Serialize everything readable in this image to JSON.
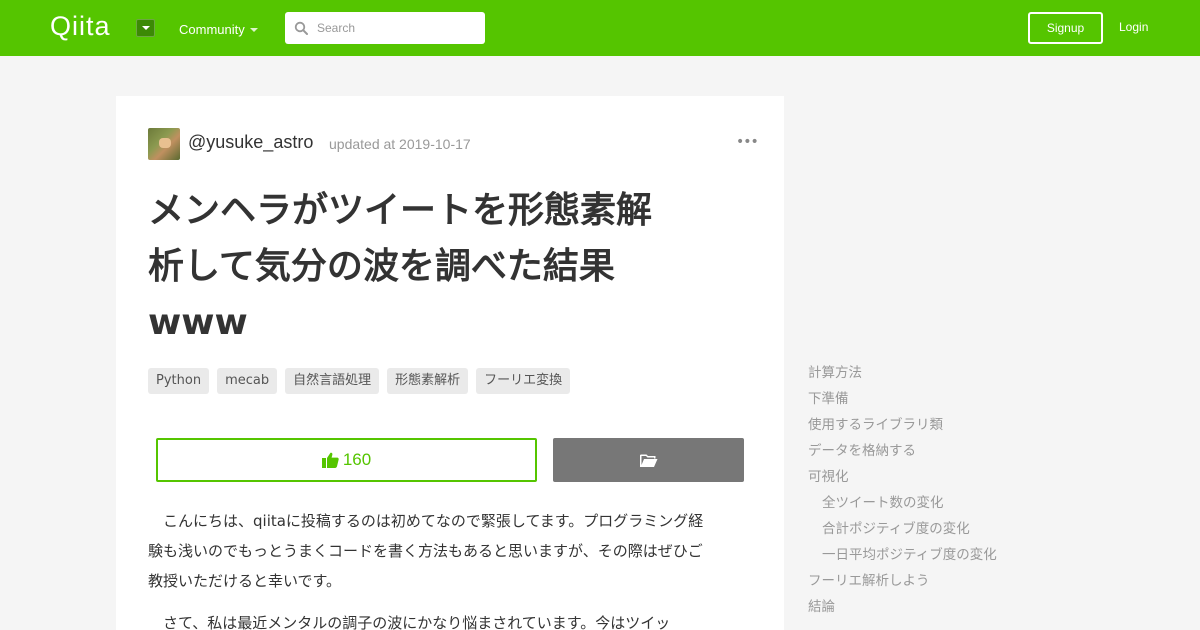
{
  "header": {
    "logo": "Qiita",
    "community_label": "Community",
    "search_placeholder": "Search",
    "signup_label": "Signup",
    "login_label": "Login",
    "brand_color": "#55c500"
  },
  "article": {
    "author": "@yusuke_astro",
    "updated": "updated at 2019-10-17",
    "more": "•••",
    "title_lines": [
      "メンヘラがツイートを形態素解",
      "析して気分の波を調べた結果",
      "www"
    ],
    "tags": [
      "Python",
      "mecab",
      "自然言語処理",
      "形態素解析",
      "フーリエ変換"
    ],
    "like_count": "160",
    "body_lines": [
      "こんにちは、qiitaに投稿するのは初めてなので緊張してます。プログラミング経",
      "験も浅いのでもっとうまくコードを書く方法もあると思いますが、その際はぜひご",
      "教授いただけると幸いです。",
      "さて、私は最近メンタルの調子の波にかなり悩まされています。今はツイッ"
    ]
  },
  "toc": {
    "items": [
      {
        "label": "計算方法",
        "sub": false
      },
      {
        "label": "下準備",
        "sub": false
      },
      {
        "label": "使用するライブラリ類",
        "sub": false
      },
      {
        "label": "データを格納する",
        "sub": false
      },
      {
        "label": "可視化",
        "sub": false
      },
      {
        "label": "全ツイート数の変化",
        "sub": true
      },
      {
        "label": "合計ポジティブ度の変化",
        "sub": true
      },
      {
        "label": "一日平均ポジティブ度の変化",
        "sub": true
      },
      {
        "label": "フーリエ解析しよう",
        "sub": false
      },
      {
        "label": "結論",
        "sub": false
      }
    ]
  }
}
